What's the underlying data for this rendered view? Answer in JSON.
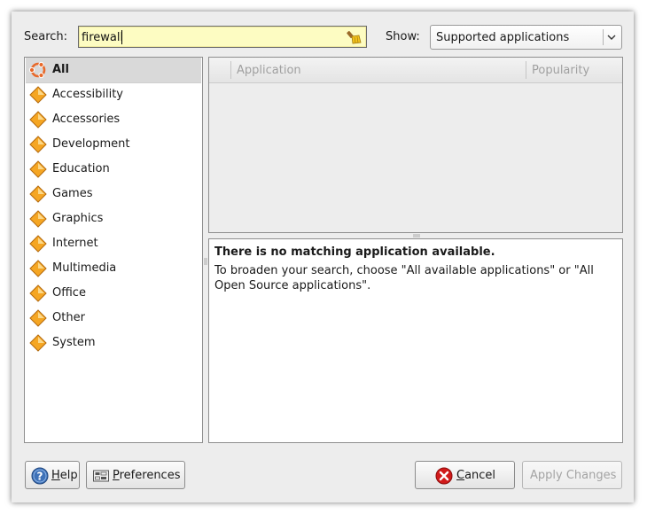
{
  "search": {
    "label": "Search:",
    "value": "firewall"
  },
  "show": {
    "label": "Show:",
    "selected": "Supported applications"
  },
  "categories": [
    {
      "label": "All",
      "icon": "ubuntu-logo-icon",
      "selected": true
    },
    {
      "label": "Accessibility",
      "icon": "category-diamond-icon"
    },
    {
      "label": "Accessories",
      "icon": "category-diamond-icon"
    },
    {
      "label": "Development",
      "icon": "category-diamond-icon"
    },
    {
      "label": "Education",
      "icon": "category-diamond-icon"
    },
    {
      "label": "Games",
      "icon": "category-diamond-icon"
    },
    {
      "label": "Graphics",
      "icon": "category-diamond-icon"
    },
    {
      "label": "Internet",
      "icon": "category-diamond-icon"
    },
    {
      "label": "Multimedia",
      "icon": "category-diamond-icon"
    },
    {
      "label": "Office",
      "icon": "category-diamond-icon"
    },
    {
      "label": "Other",
      "icon": "category-diamond-icon"
    },
    {
      "label": "System",
      "icon": "category-diamond-icon"
    }
  ],
  "app_table": {
    "columns": [
      "Application",
      "Popularity"
    ]
  },
  "description": {
    "heading": "There is no matching application available.",
    "body": "To broaden your search, choose \"All available applications\" or \"All Open Source applications\"."
  },
  "buttons": {
    "help": {
      "mnemonic": "H",
      "rest": "elp"
    },
    "preferences": {
      "mnemonic": "P",
      "rest": "references"
    },
    "cancel": {
      "mnemonic": "C",
      "rest": "ancel"
    },
    "apply": "Apply Changes"
  },
  "colors": {
    "search_bg": "#fdfcc2",
    "selection_bg": "#d9d9d9",
    "category_icon": "#f5a623",
    "cancel_icon": "#d11a1a"
  }
}
